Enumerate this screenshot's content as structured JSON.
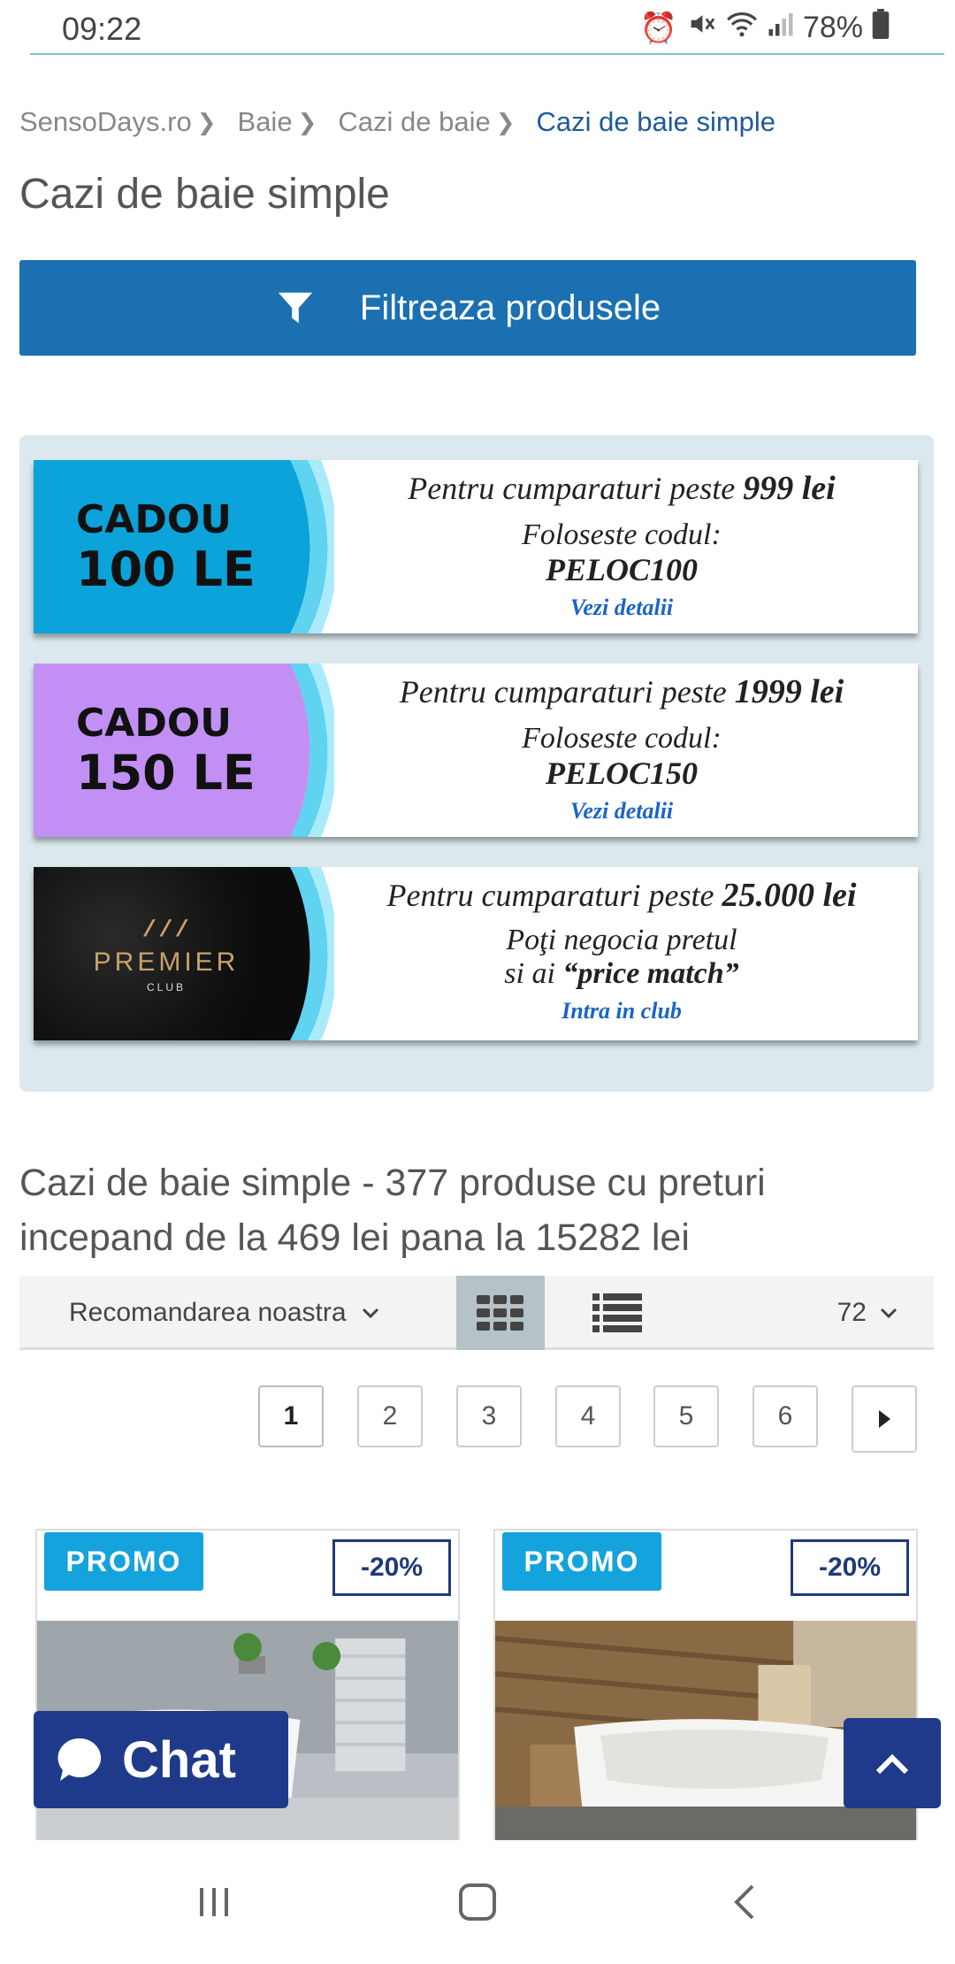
{
  "status_bar": {
    "time": "09:22",
    "battery": "78%",
    "icons": [
      "alarm-icon",
      "mute-icon",
      "wifi-icon",
      "signal-icon",
      "battery-icon"
    ]
  },
  "breadcrumb": {
    "items": [
      "SensoDays.ro",
      "Baie",
      "Cazi de baie"
    ],
    "current": "Cazi de baie simple"
  },
  "page_title": "Cazi de baie simple",
  "filter_button": {
    "label": "Filtreaza produsele"
  },
  "banners": [
    {
      "badge_title": "CADOU",
      "badge_amount": "100 LEI",
      "line1_prefix": "Pentru cumparaturi peste ",
      "line1_amount": "999 lei",
      "line2": "Foloseste codul:",
      "code": "PELOC100",
      "link": "Vezi detalii",
      "color": "#0ba3d9"
    },
    {
      "badge_title": "CADOU",
      "badge_amount": "150 LEI",
      "line1_prefix": "Pentru cumparaturi peste ",
      "line1_amount": "1999 lei",
      "line2": "Foloseste codul:",
      "code": "PELOC150",
      "link": "Vezi detalii",
      "color": "#c290f5"
    },
    {
      "logo_name": "PREMIER",
      "logo_sub": "CLUB",
      "line1_prefix": "Pentru cumparaturi peste ",
      "line1_amount": "25.000 lei",
      "line2a": "Poţi negocia pretul",
      "line2b_prefix": "si ai ",
      "line2b_bold": "“price match”",
      "link": "Intra in club",
      "color": "#111111"
    }
  ],
  "summary": "Cazi de baie simple - 377 produse cu preturi incepand de la 469 lei pana la 15282 lei",
  "toolbar": {
    "sort_label": "Recomandarea noastra",
    "per_page": "72"
  },
  "pagination": {
    "pages": [
      "1",
      "2",
      "3",
      "4",
      "5",
      "6"
    ],
    "active": "1"
  },
  "products": [
    {
      "promo": "PROMO",
      "discount": "-20%"
    },
    {
      "promo": "PROMO",
      "discount": "-20%"
    }
  ],
  "chat_button": {
    "label": "Chat"
  },
  "colors": {
    "primary": "#1a70b0",
    "navy": "#1f3a8a",
    "promo": "#14a3dc",
    "breadcrumb_current": "#1f5a99"
  }
}
